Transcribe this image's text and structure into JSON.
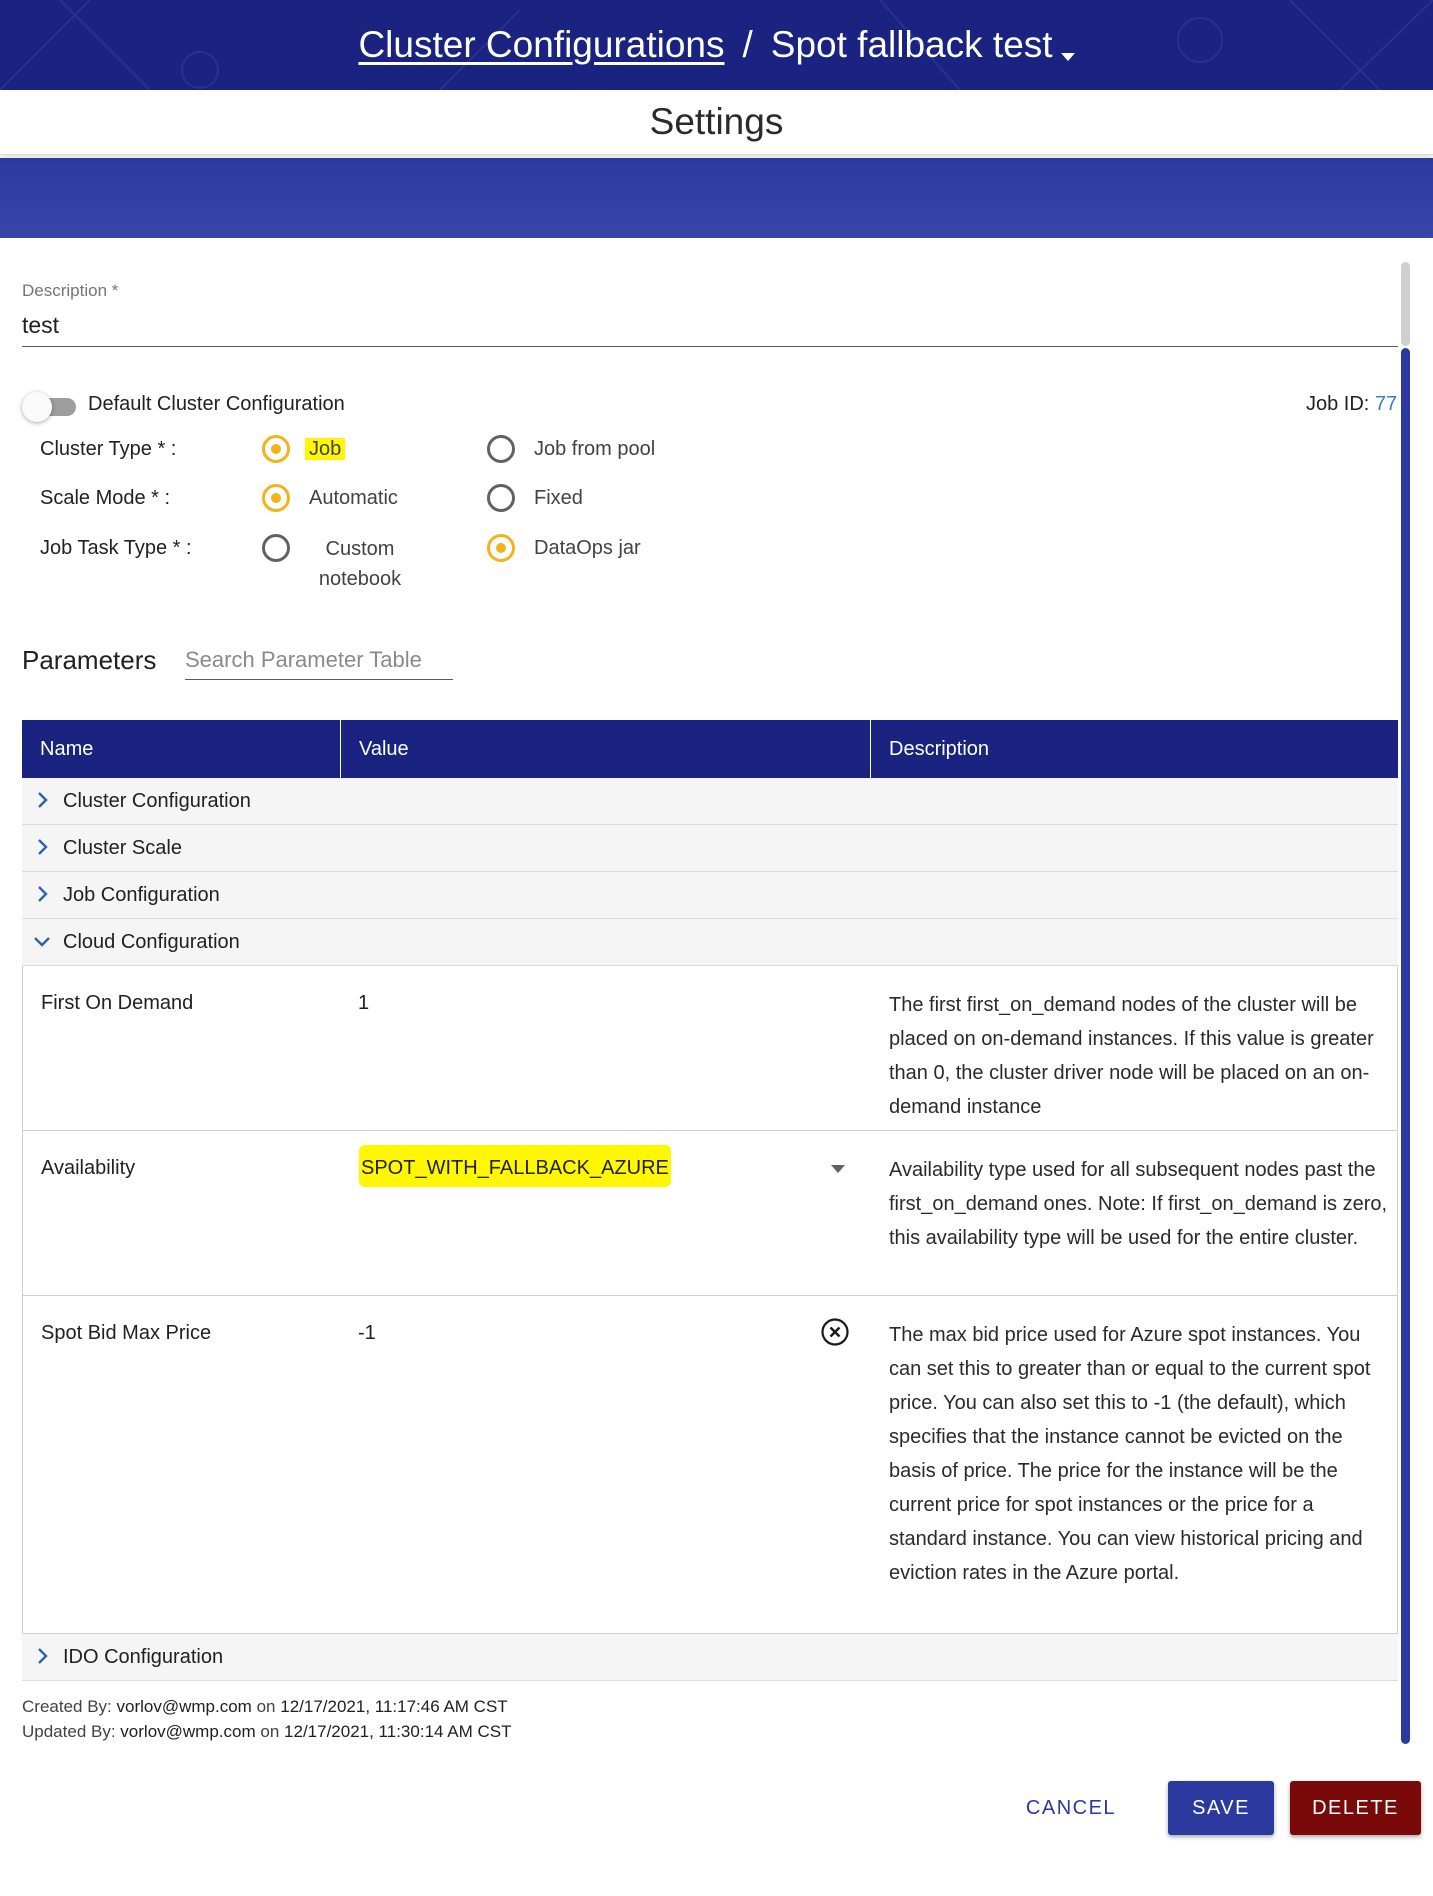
{
  "header": {
    "breadcrumb_link": "Cluster Configurations",
    "separator": "/",
    "config_name": "Spot fallback test"
  },
  "page_title": "Settings",
  "form": {
    "description_label": "Description *",
    "description_value": "test",
    "default_toggle_label": "Default Cluster Configuration",
    "default_toggle_on": false,
    "job_id_label": "Job ID:",
    "job_id_value": "77",
    "cluster_type": {
      "label": "Cluster Type * :",
      "options": [
        "Job",
        "Job from pool"
      ],
      "selected": "Job"
    },
    "scale_mode": {
      "label": "Scale Mode * :",
      "options": [
        "Automatic",
        "Fixed"
      ],
      "selected": "Automatic"
    },
    "job_task_type": {
      "label": "Job Task Type * :",
      "options": [
        "Custom notebook",
        "DataOps jar"
      ],
      "selected": "DataOps jar"
    }
  },
  "parameters": {
    "title": "Parameters",
    "search_placeholder": "Search Parameter Table",
    "columns": [
      "Name",
      "Value",
      "Description"
    ],
    "groups": [
      "Cluster Configuration",
      "Cluster Scale",
      "Job Configuration",
      "Cloud Configuration",
      "IDO Configuration"
    ],
    "rows": [
      {
        "name": "First On Demand",
        "value": "1",
        "description": "The first first_on_demand nodes of the cluster will be placed on on-demand instances. If this value is greater than 0, the cluster driver node will be placed on an on-demand instance"
      },
      {
        "name": "Availability",
        "value": "SPOT_WITH_FALLBACK_AZURE",
        "description": "Availability type used for all subsequent nodes past the first_on_demand ones. Note: If first_on_demand is zero, this availability type will be used for the entire cluster."
      },
      {
        "name": "Spot Bid Max Price",
        "value": "-1",
        "description": "The max bid price used for Azure spot instances. You can set this to greater than or equal to the current spot price. You can also set this to -1 (the default), which specifies that the instance cannot be evicted on the basis of price. The price for the instance will be the current price for spot instances or the price for a standard instance. You can view historical pricing and eviction rates in the Azure portal."
      }
    ]
  },
  "audit": {
    "created_label": "Created By:",
    "created_user": "vorlov@wmp.com",
    "on": "on",
    "created_at": "12/17/2021, 11:17:46 AM CST",
    "updated_label": "Updated By:",
    "updated_user": "vorlov@wmp.com",
    "updated_at": "12/17/2021, 11:30:14 AM CST"
  },
  "actions": {
    "cancel": "CANCEL",
    "save": "SAVE",
    "delete": "DELETE"
  },
  "colors": {
    "header_bg": "#1a2380",
    "accent": "#2c3aa0",
    "radio_selected": "#f2b41a",
    "delete": "#7a0a0a",
    "highlight": "#fff700"
  }
}
